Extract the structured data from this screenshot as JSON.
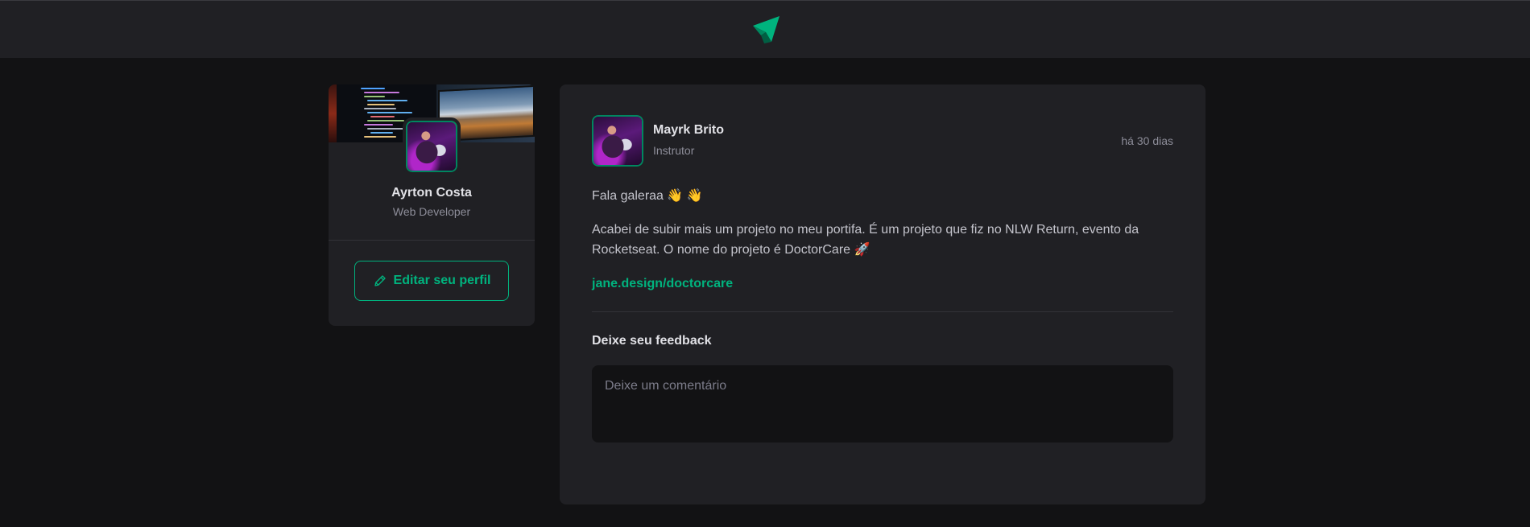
{
  "header": {
    "logo_icon": "paper-plane-logo-icon"
  },
  "sidebar": {
    "profile": {
      "name": "Ayrton Costa",
      "role": "Web Developer"
    },
    "edit_button_label": "Editar seu perfil",
    "edit_icon": "pencil-icon"
  },
  "post": {
    "author": {
      "name": "Mayrk Brito",
      "role": "Instrutor"
    },
    "published": "há 30 dias",
    "content": {
      "greeting": "Fala galeraa 👋 👋",
      "body": "Acabei de subir mais um projeto no meu portifa. É um projeto que fiz no NLW Return, evento da Rocketseat. O nome do projeto é DoctorCare 🚀",
      "link": "jane.design/doctorcare"
    },
    "feedback": {
      "title": "Deixe seu feedback",
      "placeholder": "Deixe um comentário"
    }
  },
  "colors": {
    "brand_green": "#00b37e",
    "brand_green_dark": "#00875f",
    "background": "#121214",
    "surface": "#202024"
  }
}
